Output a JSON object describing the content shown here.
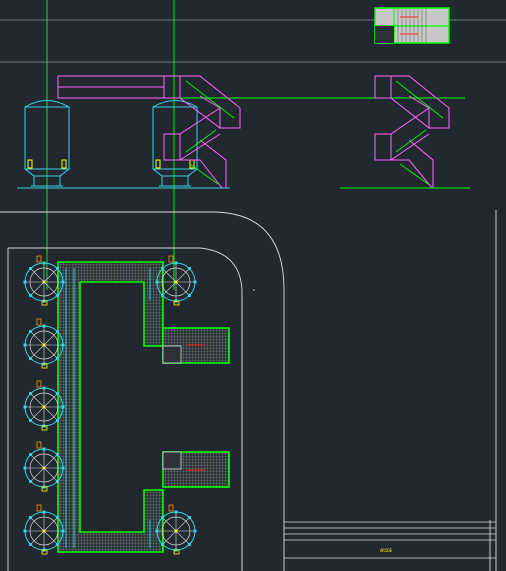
{
  "drawing": {
    "background": "#212830",
    "colors": {
      "line_gray": "#8a8f93",
      "line_white": "#d9dde0",
      "green": "#00ff00",
      "magenta": "#ff66ff",
      "cyan": "#33d6e6",
      "yellow": "#ffff00",
      "red": "#ff2020",
      "orange": "#ff9900",
      "mesh": "#7d8a8c"
    },
    "label_small": "ARIDE"
  }
}
